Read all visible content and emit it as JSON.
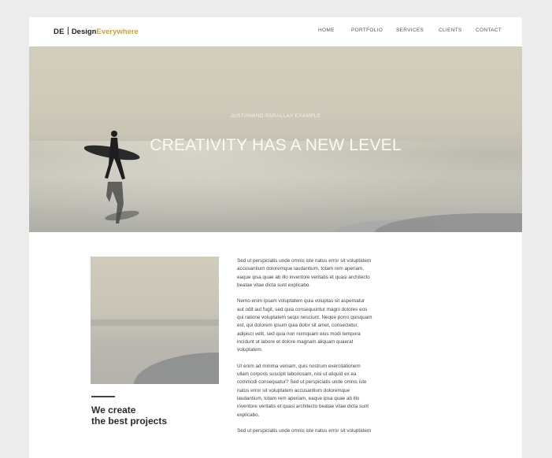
{
  "header": {
    "logo_mark": "DE",
    "logo_design": "Design",
    "logo_everywhere": "Everywhere",
    "nav": [
      "HOME",
      "PORTFOLIO",
      "SERVICES",
      "CLIENTS",
      "CONTACT"
    ]
  },
  "hero": {
    "subtitle": "JUSTINMIND PARALLAX EXAMPLE",
    "title": "CREATIVITY HAS A NEW LEVEL"
  },
  "content": {
    "tagline_line1": "We create",
    "tagline_line2": "the best projects",
    "paragraphs": [
      "Sed ut perspiciatis unde omnis iste natus error sit voluptatem\naccusantium doloremque laudantium, totam rem aperiam,\neaque ipsa quae ab illo inventore veritatis et quasi architecto\nbeatae vitae dicta sunt explicabo.",
      "Nemo enim ipsam voluptatem quia voluptas sit aspernatur\naut odit aut fugit, sed quia consequuntur magni dolores eos\nqui ratione voluptatem sequi nesciunt. Neque porro quisquam\nest, qui dolorem ipsum quia dolor sit amet, consectetur,\nadipisci velit, sed quia non numquam eius modi tempora\nincidunt ut labore et dolore magnam aliquam quaerat\nvoluptatem.",
      "Ut enim ad minima veniam, quis nostrum exercitationem\nullam corporis suscipit laboriosam, nisi ut aliquid ex ea\ncommodi consequatur? Sed ut perspiciatis unde omnis iste\nnatus error sit voluptatem accusantium doloremque\nlaudantium, totam rem aperiam, eaque ipsa quae ab illo\ninventore veritatis et quasi architecto beatae vitae dicta sunt\nexplicabo.",
      "Sed ut perspiciatis unde omnis iste natus error sit voluptatem"
    ]
  },
  "colors": {
    "accent": "#c8a24a",
    "text_dark": "#2b2b2b"
  }
}
